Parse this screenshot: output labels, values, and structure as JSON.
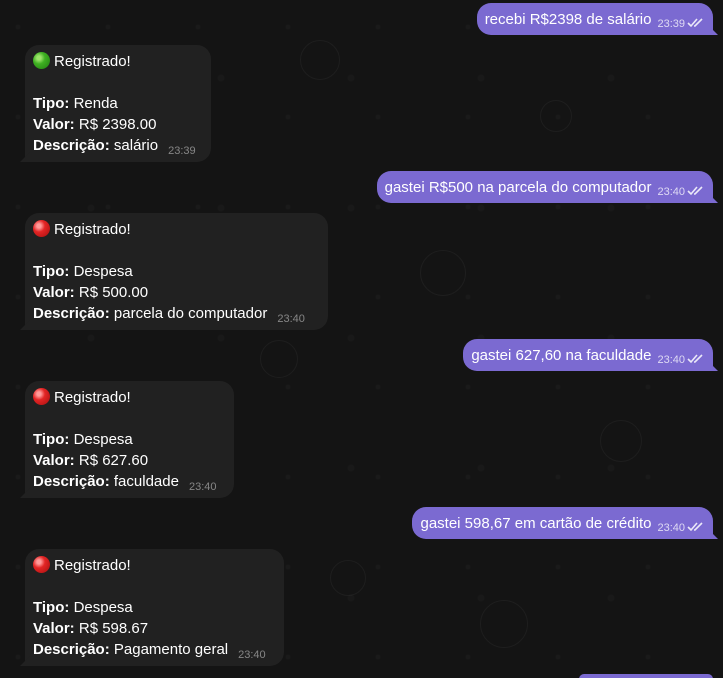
{
  "chat": {
    "messages": [
      {
        "direction": "out",
        "text": "recebi R$2398 de salário",
        "time": "23:39",
        "status": "read"
      },
      {
        "direction": "in",
        "header": "Registrado!",
        "status_icon": "green-circle-icon",
        "tipo_label": "Tipo:",
        "tipo": "Renda",
        "valor_label": "Valor:",
        "valor": "R$ 2398.00",
        "descricao_label": "Descrição:",
        "descricao": "salário",
        "time": "23:39"
      },
      {
        "direction": "out",
        "text": "gastei R$500 na parcela do computador",
        "time": "23:40",
        "status": "read"
      },
      {
        "direction": "in",
        "header": "Registrado!",
        "status_icon": "red-circle-icon",
        "tipo_label": "Tipo:",
        "tipo": "Despesa",
        "valor_label": "Valor:",
        "valor": "R$ 500.00",
        "descricao_label": "Descrição:",
        "descricao": "parcela do computador",
        "time": "23:40"
      },
      {
        "direction": "out",
        "text": "gastei 627,60 na faculdade",
        "time": "23:40",
        "status": "read"
      },
      {
        "direction": "in",
        "header": "Registrado!",
        "status_icon": "red-circle-icon",
        "tipo_label": "Tipo:",
        "tipo": "Despesa",
        "valor_label": "Valor:",
        "valor": "R$ 627.60",
        "descricao_label": "Descrição:",
        "descricao": "faculdade",
        "time": "23:40"
      },
      {
        "direction": "out",
        "text": "gastei 598,67 em cartão de crédito",
        "time": "23:40",
        "status": "read"
      },
      {
        "direction": "in",
        "header": "Registrado!",
        "status_icon": "red-circle-icon",
        "tipo_label": "Tipo:",
        "tipo": "Despesa",
        "valor_label": "Valor:",
        "valor": "R$ 598.67",
        "descricao_label": "Descrição:",
        "descricao": "Pagamento geral",
        "time": "23:40"
      }
    ]
  },
  "colors": {
    "background": "#141414",
    "outgoing_bubble": "#7b6ad1",
    "incoming_bubble": "#212121",
    "income_dot": "#3fb022",
    "expense_dot": "#e32525"
  }
}
